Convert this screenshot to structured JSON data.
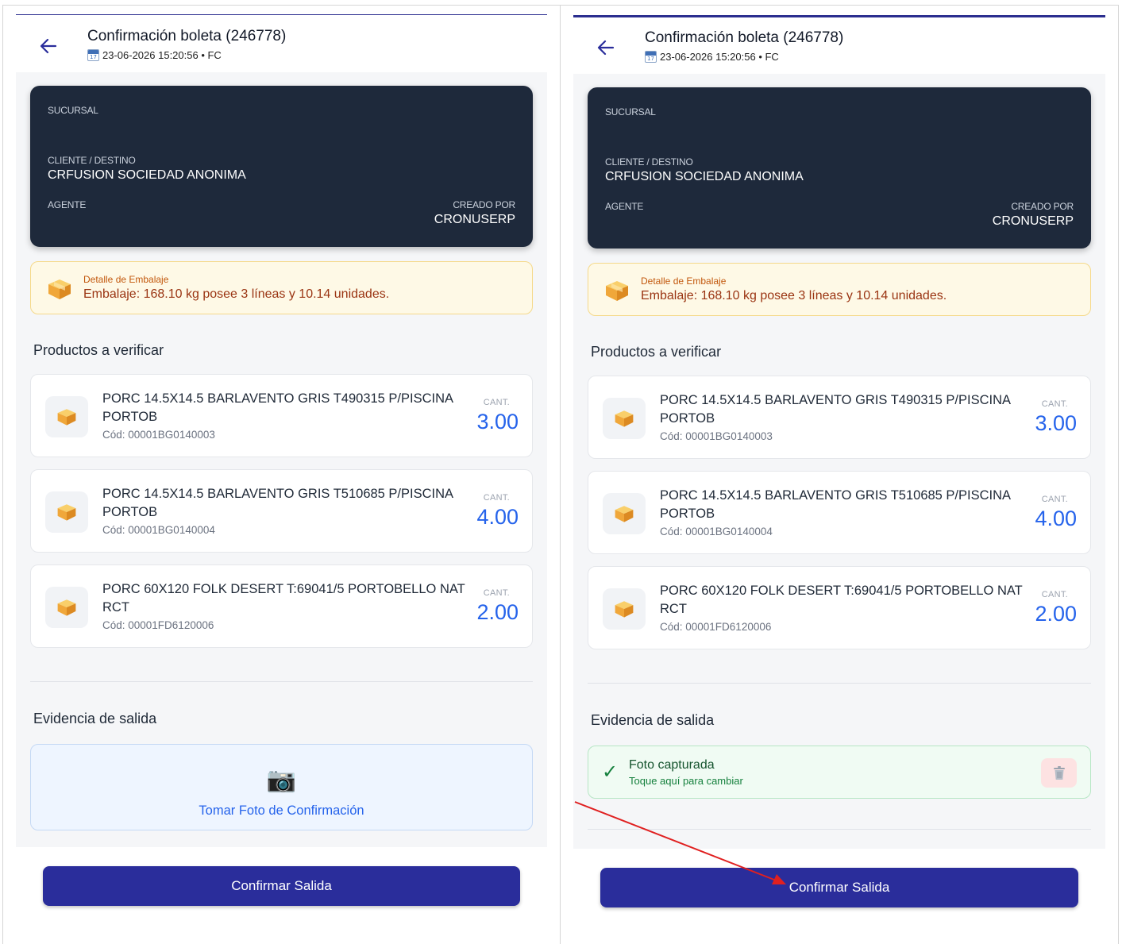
{
  "header": {
    "title": "Confirmación boleta (246778)",
    "subtitle": "23-06-2026 15:20:56 • FC"
  },
  "summary": {
    "branch_label": "SUCURSAL",
    "client_label": "CLIENTE / DESTINO",
    "client_value": "CRFUSION SOCIEDAD ANONIMA",
    "agent_label": "AGENTE",
    "created_by_label": "CREADO POR",
    "created_by_value": "CRONUSERP"
  },
  "packaging": {
    "label": "Detalle de Embalaje",
    "text": "Embalaje: 168.10 kg posee 3 líneas y 10.14 unidades."
  },
  "products_title": "Productos a verificar",
  "qty_label": "CANT.",
  "products": [
    {
      "name": "PORC 14.5X14.5 BARLAVENTO GRIS T490315 P/PISCINA PORTOB",
      "code": "Cód: 00001BG0140003",
      "qty": "3.00"
    },
    {
      "name": "PORC 14.5X14.5 BARLAVENTO GRIS T510685 P/PISCINA PORTOB",
      "code": "Cód: 00001BG0140004",
      "qty": "4.00"
    },
    {
      "name": "PORC 60X120 FOLK DESERT T:69041/5  PORTOBELLO NAT RCT",
      "code": "Cód: 00001FD6120006",
      "qty": "2.00"
    }
  ],
  "evidence": {
    "title": "Evidencia de salida",
    "take_photo_label": "Tomar Foto de Confirmación",
    "captured_title": "Foto capturada",
    "captured_sub": "Toque aquí para cambiar"
  },
  "confirm_label": "Confirmar Salida",
  "icons": {
    "back": "arrow-left-icon",
    "calendar": "calendar-icon",
    "package": "package-icon",
    "camera": "camera-icon",
    "check": "check-icon",
    "trash": "trash-icon"
  },
  "colors": {
    "primary": "#2a2d9b",
    "dark_card": "#1e293b",
    "qty_blue": "#2563eb",
    "warning_bg": "#fef9e6",
    "success_bg": "#f0fbf3",
    "annotation_arrow": "#e02020"
  }
}
